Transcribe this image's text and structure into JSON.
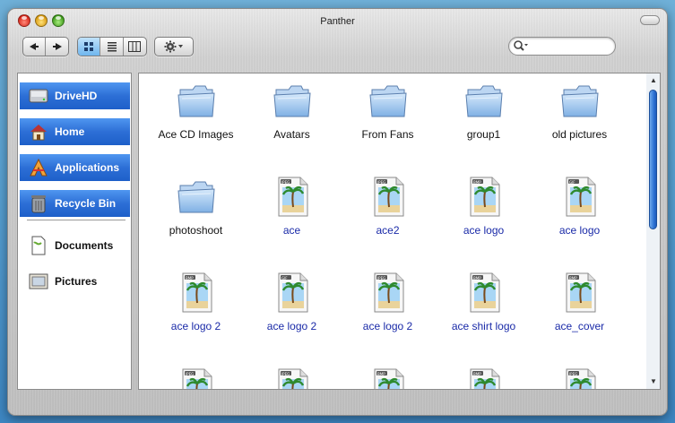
{
  "window": {
    "title": "Panther"
  },
  "toolbar": {
    "back_label": "◀",
    "forward_label": "▶",
    "view_icon_label": "icon-view",
    "view_list_label": "list-view",
    "view_column_label": "column-view",
    "action_icon": "gear-icon",
    "search": {
      "value": "",
      "placeholder": ""
    }
  },
  "sidebar": {
    "items": [
      {
        "label": "DriveHD",
        "icon": "hard-drive-icon",
        "selected": true
      },
      {
        "label": "Home",
        "icon": "home-icon",
        "selected": true
      },
      {
        "label": "Applications",
        "icon": "applications-icon",
        "selected": true
      },
      {
        "label": "Recycle Bin",
        "icon": "trash-icon",
        "selected": true
      },
      {
        "label": "Documents",
        "icon": "document-icon",
        "selected": false
      },
      {
        "label": "Pictures",
        "icon": "pictures-icon",
        "selected": false
      }
    ]
  },
  "files": [
    {
      "name": "Ace CD Images",
      "kind": "folder"
    },
    {
      "name": "Avatars",
      "kind": "folder"
    },
    {
      "name": "From Fans",
      "kind": "folder"
    },
    {
      "name": "group1",
      "kind": "folder"
    },
    {
      "name": "old pictures",
      "kind": "folder"
    },
    {
      "name": "photoshoot",
      "kind": "folder"
    },
    {
      "name": "ace",
      "kind": "image",
      "badge": "JPEG"
    },
    {
      "name": "ace2",
      "kind": "image",
      "badge": "JPEG"
    },
    {
      "name": "ace logo",
      "kind": "image",
      "badge": "BMP"
    },
    {
      "name": "ace logo",
      "kind": "image",
      "badge": "GIF"
    },
    {
      "name": "ace logo 2",
      "kind": "image",
      "badge": "BMP"
    },
    {
      "name": "ace logo 2",
      "kind": "image",
      "badge": "GIF"
    },
    {
      "name": "ace logo 2",
      "kind": "image",
      "badge": "JPEG"
    },
    {
      "name": "ace shirt logo",
      "kind": "image",
      "badge": "BMP"
    },
    {
      "name": "ace_cover",
      "kind": "image",
      "badge": "BMP"
    },
    {
      "name": "",
      "kind": "image",
      "badge": "JPEG"
    },
    {
      "name": "",
      "kind": "image",
      "badge": "JPEG"
    },
    {
      "name": "",
      "kind": "image",
      "badge": "BMP"
    },
    {
      "name": "",
      "kind": "image",
      "badge": "BMP"
    },
    {
      "name": "",
      "kind": "image",
      "badge": "JPEG"
    }
  ],
  "colors": {
    "selection": "#2d6fd6",
    "file_label": "#1a2aa8",
    "folder_label": "#111111"
  }
}
